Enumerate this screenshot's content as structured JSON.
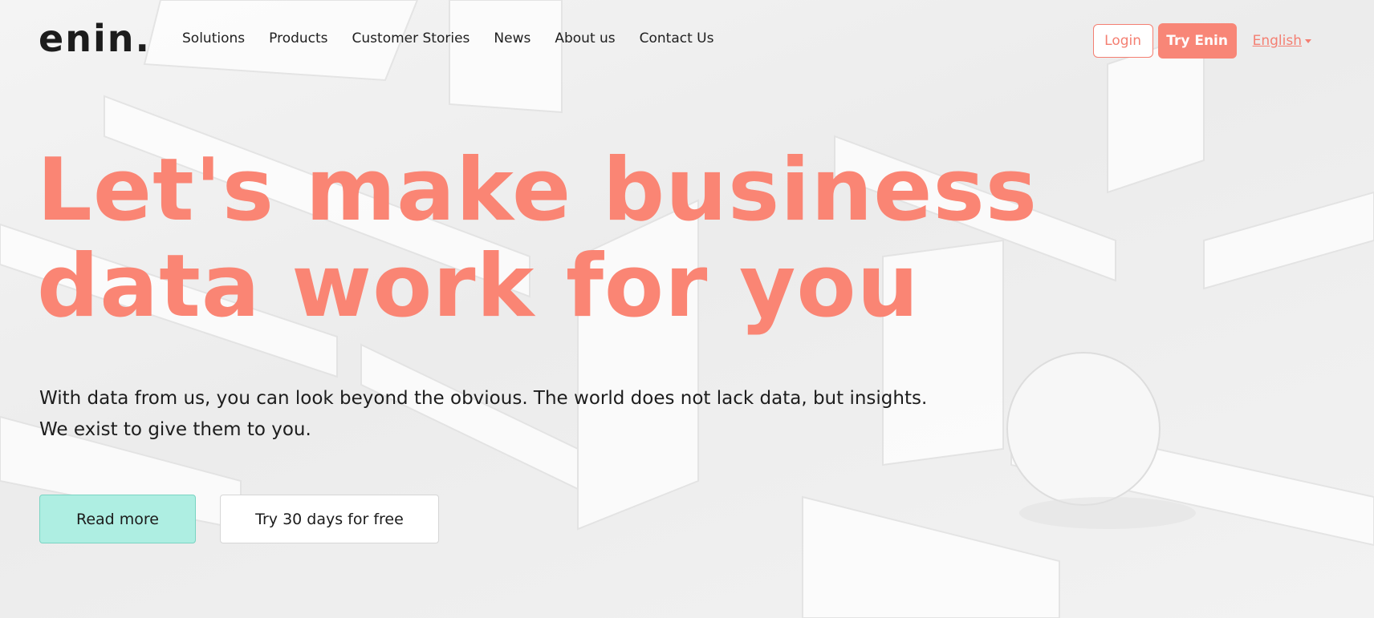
{
  "brand": {
    "logo_text": "enin.",
    "accent_color": "#fa8574",
    "secondary_color": "#aeeee2"
  },
  "nav": {
    "links": [
      "Solutions",
      "Products",
      "Customer Stories",
      "News",
      "About us",
      "Contact Us"
    ],
    "login_label": "Login",
    "try_label": "Try Enin",
    "language_label": "English"
  },
  "hero": {
    "title": "Let's make business data work for you",
    "subtitle_line1": "With data from us, you can look beyond the obvious. The world does not lack data, but insights.",
    "subtitle_line2": "We exist to give them to you.",
    "read_more_label": "Read more",
    "trial_label": "Try 30 days for free"
  }
}
